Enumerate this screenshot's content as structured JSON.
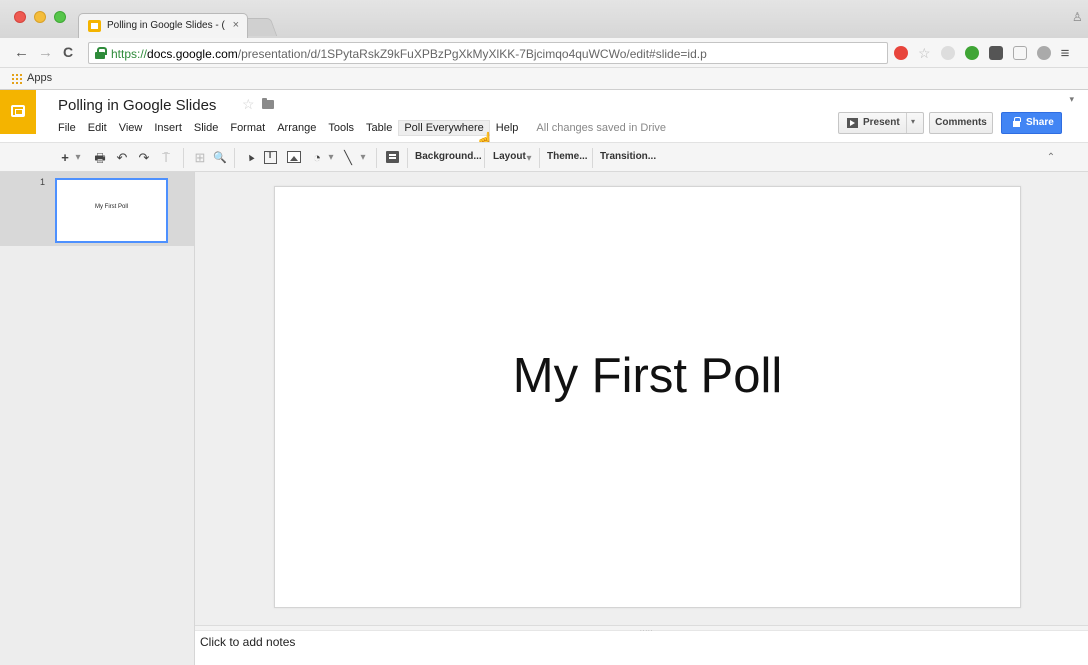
{
  "browser": {
    "tab_title": "Polling in Google Slides - (",
    "tab_close": "×",
    "url_scheme": "https://",
    "url_host": "docs.google.com",
    "url_path": "/presentation/d/1SPytaRskZ9kFuXPBzPgXkMyXlKK-7Bjcimqo4quWCWo/edit#slide=id.p",
    "back": "←",
    "forward": "→",
    "reload": "C",
    "menu": "≡",
    "bookmarks_apps": "Apps",
    "extension_colors": [
      "#e8453c",
      "#dddddd",
      "#3fa535",
      "#555555",
      "#555555",
      "#aaaaaa",
      "#555555"
    ]
  },
  "app": {
    "accent_color": "#f4b400",
    "doc_title": "Polling in Google Slides",
    "star": "☆",
    "menu": [
      "File",
      "Edit",
      "View",
      "Insert",
      "Slide",
      "Format",
      "Arrange",
      "Tools",
      "Table",
      "Poll Everywhere",
      "Help"
    ],
    "hovered_menu": "Poll Everywhere",
    "saved_status": "All changes saved in Drive",
    "collapse_caret": "▾",
    "present_label": "Present",
    "present_caret": "▾",
    "comments_label": "Comments",
    "share_label": "Share",
    "share_color": "#4285f4"
  },
  "toolbar": {
    "new_slide": "+",
    "new_slide_caret": "▾",
    "print": "🖶",
    "undo": "↶",
    "redo": "↷",
    "paint_format": "⍑",
    "zoom": "🔍",
    "select": "▲",
    "shape_caret": "▾",
    "line": "╲",
    "line_caret": "▾",
    "background": "Background...",
    "layout": "Layout",
    "layout_caret": "▾",
    "theme": "Theme...",
    "transition": "Transition...",
    "collapse": "⌃"
  },
  "filmstrip": {
    "slides": [
      {
        "number": "1",
        "title": "My First Poll",
        "selected": true
      }
    ]
  },
  "slide": {
    "title": "My First Poll"
  },
  "notes": {
    "placeholder": "Click to add notes",
    "grip": "....."
  }
}
